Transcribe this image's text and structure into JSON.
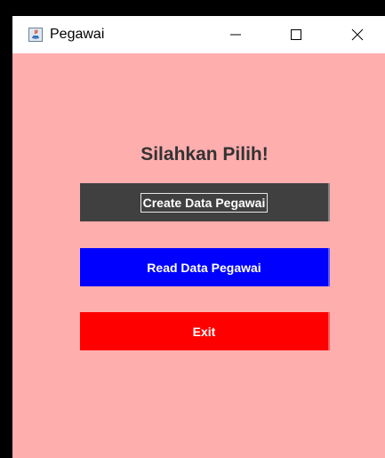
{
  "window": {
    "title": "Pegawai",
    "app_icon": "java-app-icon",
    "controls": {
      "minimize": "minimize-icon",
      "maximize": "maximize-icon",
      "close": "close-icon"
    }
  },
  "main": {
    "heading": "Silahkan Pilih!",
    "buttons": {
      "create": "Create Data Pegawai",
      "read": "Read Data Pegawai",
      "exit": "Exit"
    }
  },
  "colors": {
    "background": "#ffaeae",
    "create_button": "#404040",
    "read_button": "#0000ff",
    "exit_button": "#ff0000"
  }
}
